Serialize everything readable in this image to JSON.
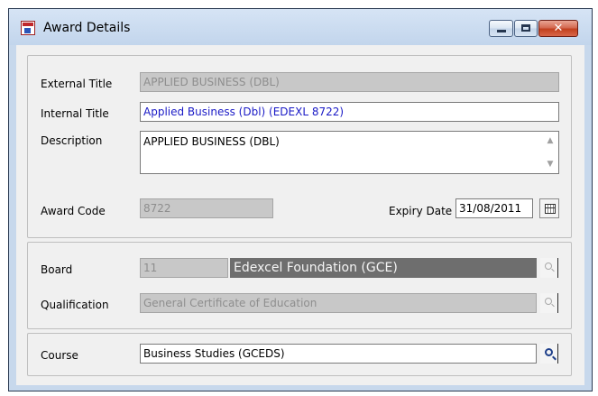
{
  "window": {
    "title": "Award Details",
    "controls": {
      "minimize": "minimize",
      "maximize": "maximize",
      "close": "✕"
    }
  },
  "award": {
    "external_title_label": "External Title",
    "external_title_value": "APPLIED BUSINESS (DBL)",
    "internal_title_label": "Internal Title",
    "internal_title_value": "Applied Business (Dbl) (EDEXL 8722)",
    "description_label": "Description",
    "description_value": "APPLIED BUSINESS (DBL)",
    "award_code_label": "Award Code",
    "award_code_value": "8722",
    "expiry_date_label": "Expiry Date",
    "expiry_date_value": "31/08/2011"
  },
  "board": {
    "board_label": "Board",
    "board_code": "11",
    "board_name": "Edexcel Foundation (GCE)",
    "qualification_label": "Qualification",
    "qualification_value": "General Certificate of Education"
  },
  "course": {
    "course_label": "Course",
    "course_value": "Business Studies (GCEDS)"
  },
  "icons": {
    "app": "award-app-icon",
    "calendar": "calendar-icon",
    "lookup": "magnifier-icon",
    "scroll_up": "▲",
    "scroll_down": "▼"
  },
  "colors": {
    "internal_title_text": "#1a1ac6",
    "board_name_bg": "#6e6e6e",
    "disabled_bg": "#c8c8c8",
    "close_button": "#c2401e"
  }
}
